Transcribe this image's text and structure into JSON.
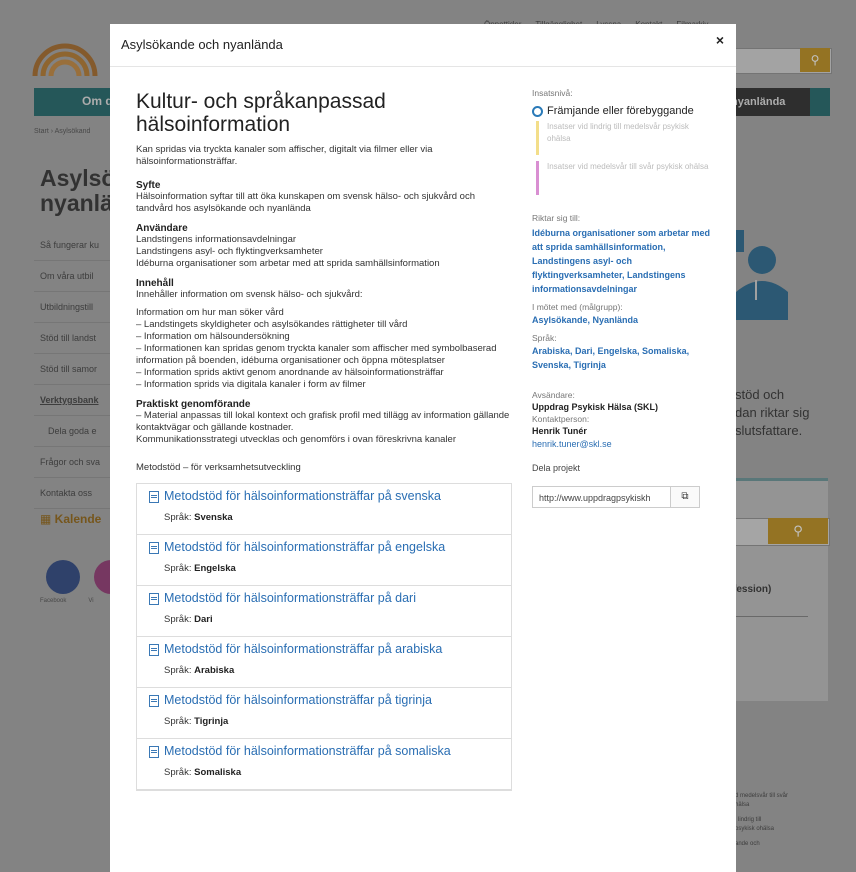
{
  "background": {
    "topnav": [
      "Öppettider",
      "Tillgänglighet",
      "Lyssna",
      "Kontakt",
      "Filmarkiv"
    ],
    "nav_left": "Om d",
    "nav_right": "& nyanlända",
    "breadcrumb": "Start › Asylsökand",
    "title_lines": [
      "Asylsök",
      "nyanlä"
    ],
    "menu": [
      "Så fungerar ku",
      "Om våra utbil",
      "Utbildningstill",
      "Stöd till landst",
      "Stöd till samor",
      "Verktygsbank",
      "Dela goda e",
      "Frågor och sva",
      "Kontakta oss"
    ],
    "kalender": "Kalende",
    "social": [
      "Facebook",
      "Vi"
    ],
    "right_text": [
      "stöd och",
      "dan riktar sig",
      "slutsfattare."
    ],
    "right_label": "fession)",
    "right_list": [
      "d medelsvår till svår",
      "hälsa",
      "i lindrig till",
      "psykisk ohälsa",
      "ande och"
    ]
  },
  "modal": {
    "title": "Asylsökande och nyanlända",
    "close": "×"
  },
  "content": {
    "title": "Kultur- och språkanpassad hälsoinformation",
    "intro": "Kan spridas via tryckta kanaler som affischer, digitalt via filmer eller via hälsoinformationsträffar.",
    "syfte_h": "Syfte",
    "syfte_p": "Hälsoinformation syftar till att öka kunskapen om svensk hälso- och sjukvård och tandvård hos asylsökande och nyanlända",
    "anv_h": "Användare",
    "anv_lines": [
      "Landstingens informationsavdelningar",
      "Landstingens asyl- och flyktingverksamheter",
      "Idéburna organisationer som arbetar med att sprida samhällsinformation"
    ],
    "inn_h": "Innehåll",
    "inn_p": "Innehåller information om svensk hälso- och sjukvård:",
    "inn_lines": [
      "Information om hur man söker vård",
      "– Landstingets skyldigheter och asylsökandes rättigheter till vård",
      "– Information om hälsoundersökning",
      "– Informationen kan spridas genom tryckta kanaler som affischer med symbolbaserad information på boenden, idéburna organisationer och öppna mötesplatser",
      "– Information sprids aktivt genom anordnande av hälsoinformationsträffar",
      "– Information sprids via digitala kanaler i form av filmer"
    ],
    "prak_h": "Praktiskt genomförande",
    "prak_lines": [
      "– Material anpassas till lokal kontext och grafisk profil med tillägg av information gällande kontaktvägar och gällande kostnader.",
      "Kommunikationsstrategi utvecklas och genomförs i ovan föreskrivna kanaler"
    ],
    "meto_label": "Metodstöd – för verksamhetsutveckling",
    "lang_prefix": "Språk:",
    "docs": [
      {
        "title": "Metodstöd för hälsoinformationsträffar på svenska",
        "lang": "Svenska"
      },
      {
        "title": "Metodstöd för hälsoinformationsträffar på engelska",
        "lang": "Engelska"
      },
      {
        "title": "Metodstöd för hälsoinformationsträffar på dari",
        "lang": "Dari"
      },
      {
        "title": "Metodstöd för hälsoinformationsträffar på arabiska",
        "lang": "Arabiska"
      },
      {
        "title": "Metodstöd för hälsoinformationsträffar på tigrinja",
        "lang": "Tigrinja"
      },
      {
        "title": "Metodstöd för hälsoinformationsträffar på somaliska",
        "lang": "Somaliska"
      }
    ]
  },
  "sidebar": {
    "insats_label": "Insatsnivå:",
    "level_active": "Främjande eller förebyggande",
    "level_yellow": "Insatser vid lindrig till medelsvår psykisk ohälsa",
    "level_pink": "Insatser vid medelsvår till svår psykisk ohälsa",
    "riktar_label": "Riktar sig till:",
    "riktar_value": "Idéburna organisationer som arbetar med att sprida samhällsinformation, Landstingens asyl- och flyktingverksamheter, Landstingens informationsavdelningar",
    "motet_label": "I mötet med (målgrupp):",
    "motet_value": "Asylsökande, Nyanlända",
    "sprak_label": "Språk:",
    "sprak_value": "Arabiska, Dari, Engelska, Somaliska, Svenska, Tigrinja",
    "avs_label": "Avsändare:",
    "avs_value": "Uppdrag Psykisk Hälsa (SKL)",
    "kontakt_label": "Kontaktperson:",
    "kontakt_name": "Henrik Tunér",
    "kontakt_email": "henrik.tuner@skl.se",
    "dela_label": "Dela projekt",
    "dela_url": "http://www.uppdragpsykiskh"
  },
  "colors": {
    "link": "#2a6eb3",
    "yellow_bar": "#f3de8a",
    "pink_bar": "#d98fd2"
  }
}
